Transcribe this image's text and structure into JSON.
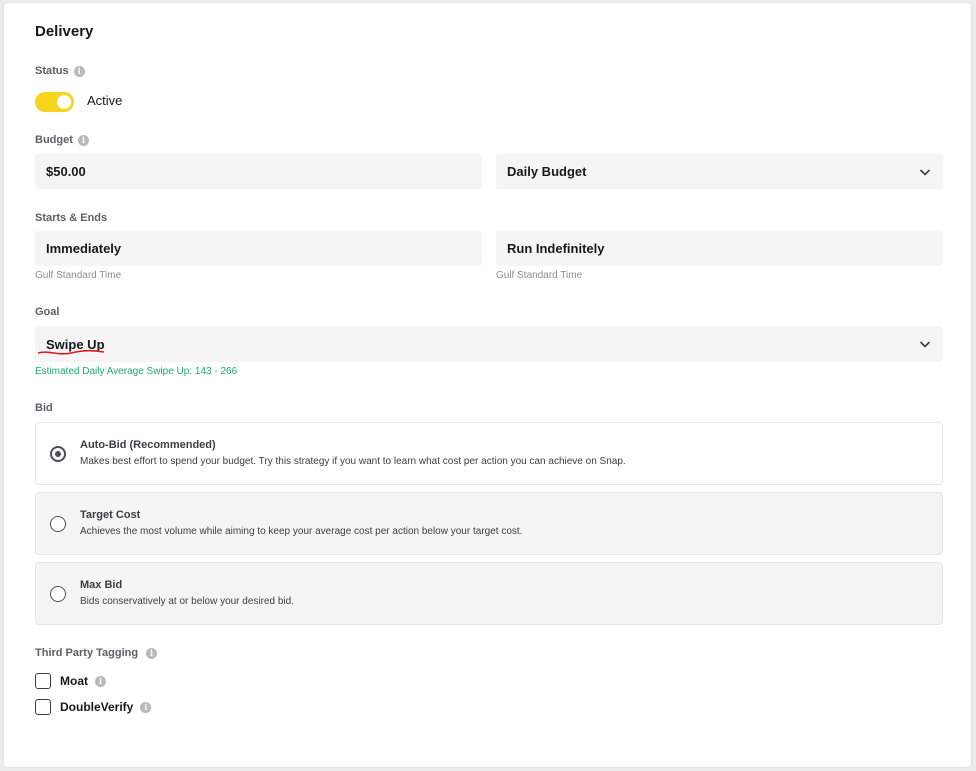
{
  "section_title": "Delivery",
  "status": {
    "label": "Status",
    "toggle_on": true,
    "toggle_label": "Active"
  },
  "budget": {
    "label": "Budget",
    "amount": "$50.00",
    "type": "Daily Budget"
  },
  "schedule": {
    "label": "Starts & Ends",
    "start": "Immediately",
    "start_tz": "Gulf Standard Time",
    "end": "Run Indefinitely",
    "end_tz": "Gulf Standard Time"
  },
  "goal": {
    "label": "Goal",
    "value": "Swipe Up",
    "estimate": "Estimated Daily Average Swipe Up: 143 - 266"
  },
  "bid": {
    "label": "Bid",
    "options": [
      {
        "title": "Auto-Bid (Recommended)",
        "desc": "Makes best effort to spend your budget. Try this strategy if you want to learn what cost per action you can achieve on Snap.",
        "selected": true
      },
      {
        "title": "Target Cost",
        "desc": "Achieves the most volume while aiming to keep your average cost per action below your target cost.",
        "selected": false
      },
      {
        "title": "Max Bid",
        "desc": "Bids conservatively at or below your desired bid.",
        "selected": false
      }
    ]
  },
  "tagging": {
    "label": "Third Party Tagging",
    "items": [
      {
        "label": "Moat",
        "checked": false
      },
      {
        "label": "DoubleVerify",
        "checked": false
      }
    ]
  },
  "colors": {
    "toggle": "#f7d51d",
    "estimate": "#1fa67a",
    "annotation": "#e0191e"
  }
}
